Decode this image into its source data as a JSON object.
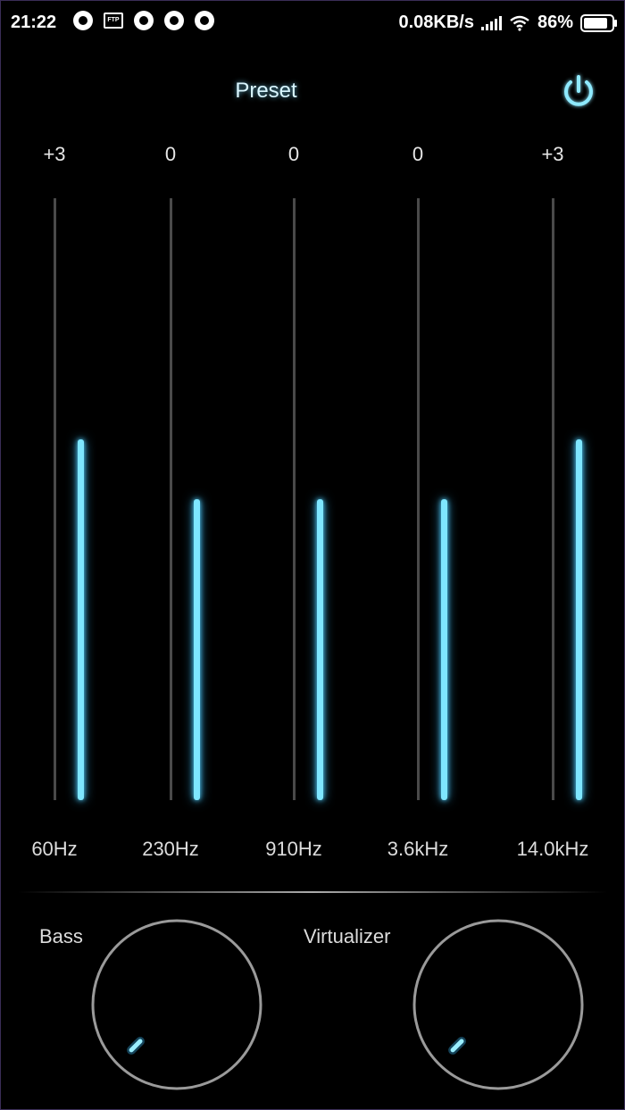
{
  "status_bar": {
    "time": "21:22",
    "network_speed": "0.08KB/s",
    "battery": "86%",
    "battery_level": 0.86,
    "notification_icons": [
      "aperture-icon",
      "ftp-icon",
      "aperture-icon",
      "aperture-icon",
      "aperture-icon"
    ]
  },
  "header": {
    "preset_label": "Preset",
    "power_icon": "power-icon",
    "accent_color": "#7ee6ff"
  },
  "bands": [
    {
      "label": "60Hz",
      "value": "+3",
      "level": 0.6
    },
    {
      "label": "230Hz",
      "value": "0",
      "level": 0.5
    },
    {
      "label": "910Hz",
      "value": "0",
      "level": 0.5
    },
    {
      "label": "3.6kHz",
      "value": "0",
      "level": 0.5
    },
    {
      "label": "14.0kHz",
      "value": "+3",
      "level": 0.6
    }
  ],
  "effects": {
    "bass_label": "Bass",
    "bass_level": 0,
    "virtualizer_label": "Virtualizer",
    "virtualizer_level": 0
  }
}
